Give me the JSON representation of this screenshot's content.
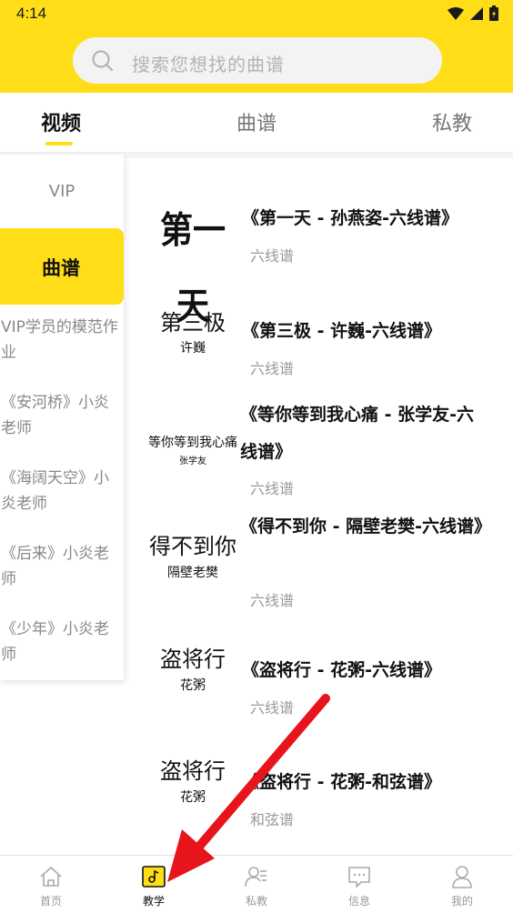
{
  "status": {
    "time": "4:14"
  },
  "search": {
    "placeholder": "搜索您想找的曲谱"
  },
  "tabs": [
    {
      "label": "视频",
      "active": true
    },
    {
      "label": "曲谱",
      "active": false
    },
    {
      "label": "私教",
      "active": false
    }
  ],
  "sidebar": {
    "items": [
      {
        "label": "VIP"
      },
      {
        "label": "曲谱",
        "active": true
      },
      {
        "label": "VIP学员的模范作业"
      },
      {
        "label": "《安河桥》小炎老师"
      },
      {
        "label": "《海阔天空》小炎老师"
      },
      {
        "label": "《后来》小炎老师"
      },
      {
        "label": "《少年》小炎老师"
      }
    ]
  },
  "list": [
    {
      "thumb_main": "第一天",
      "thumb_sub": "",
      "title": "《第一天 - 孙燕姿-六线谱》",
      "subtitle": "六线谱"
    },
    {
      "thumb_main": "第三极",
      "thumb_sub": "许巍",
      "title": "《第三极 - 许巍-六线谱》",
      "subtitle": "六线谱"
    },
    {
      "thumb_main": "等你等到我心痛",
      "thumb_sub": "张学友",
      "title": "《等你等到我心痛 - 张学友-六线谱》",
      "subtitle": "六线谱"
    },
    {
      "thumb_main": "得不到你",
      "thumb_sub": "隔壁老樊",
      "title": "《得不到你 - 隔壁老樊-六线谱》",
      "subtitle": "六线谱"
    },
    {
      "thumb_main": "盗将行",
      "thumb_sub": "花粥",
      "title": "《盗将行 - 花粥-六线谱》",
      "subtitle": "六线谱"
    },
    {
      "thumb_main": "盗将行",
      "thumb_sub": "花粥",
      "title": "《盗将行 - 花粥-和弦谱》",
      "subtitle": "和弦谱"
    }
  ],
  "bottom_nav": [
    {
      "label": "首页",
      "icon": "home-icon"
    },
    {
      "label": "教学",
      "icon": "music-note-icon",
      "active": true
    },
    {
      "label": "私教",
      "icon": "user-list-icon"
    },
    {
      "label": "信息",
      "icon": "message-icon"
    },
    {
      "label": "我的",
      "icon": "person-icon"
    }
  ],
  "colors": {
    "accent": "#FFDE17",
    "annotation_arrow": "#E8141C"
  }
}
